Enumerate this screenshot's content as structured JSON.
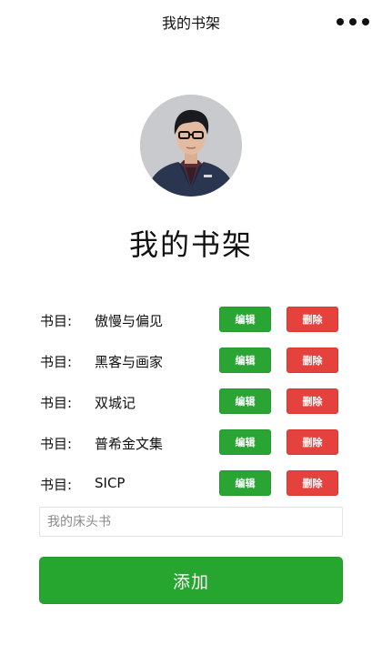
{
  "navbar": {
    "title": "我的书架",
    "more_icon": "more-dots-icon"
  },
  "avatar": {
    "description": "user-avatar"
  },
  "heading": "我的书架",
  "book_label": "书目:",
  "books": [
    {
      "title": "傲慢与偏见",
      "edit_label": "编辑",
      "delete_label": "删除"
    },
    {
      "title": "黑客与画家",
      "edit_label": "编辑",
      "delete_label": "删除"
    },
    {
      "title": "双城记",
      "edit_label": "编辑",
      "delete_label": "删除"
    },
    {
      "title": "普希金文集",
      "edit_label": "编辑",
      "delete_label": "删除"
    },
    {
      "title": "SICP",
      "edit_label": "编辑",
      "delete_label": "删除"
    }
  ],
  "new_book": {
    "placeholder": "我的床头书",
    "value": ""
  },
  "add_button_label": "添加",
  "colors": {
    "edit": "#2aa534",
    "delete": "#e5423d",
    "add": "#26a52f"
  }
}
